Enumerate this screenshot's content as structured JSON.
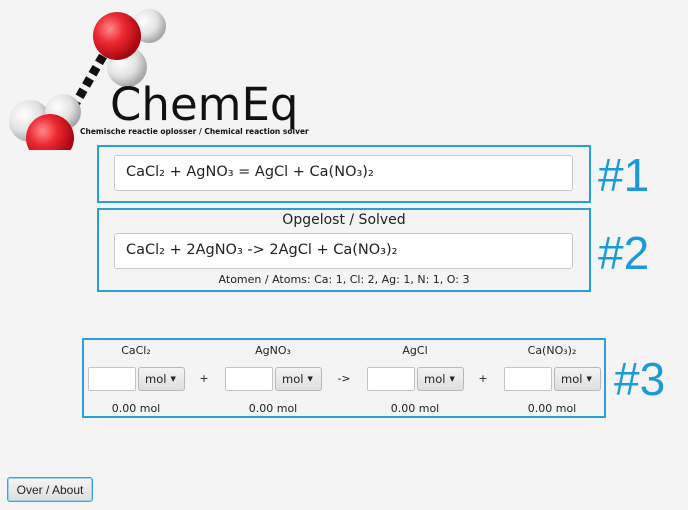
{
  "logo": {
    "title": "ChemEq",
    "subtitle": "Chemische reactie oplosser / Chemical reaction solver"
  },
  "input": {
    "equation": "CaCl₂ + AgNO₃ = AgCl + Ca(NO₃)₂"
  },
  "solved": {
    "heading": "Opgelost / Solved",
    "equation": "CaCl₂ + 2AgNO₃ -> 2AgCl + Ca(NO₃)₂",
    "atoms": "Atomen / Atoms: Ca: 1, Cl: 2, Ag: 1, N: 1, O: 3"
  },
  "annotations": {
    "one": "#1",
    "two": "#2",
    "three": "#3"
  },
  "calculator": {
    "plus1": "+",
    "arrow": "->",
    "plus2": "+",
    "compounds": [
      {
        "formula": "CaCl₂",
        "unit": "mol",
        "amount": "0.00 mol"
      },
      {
        "formula": "AgNO₃",
        "unit": "mol",
        "amount": "0.00 mol"
      },
      {
        "formula": "AgCl",
        "unit": "mol",
        "amount": "0.00 mol"
      },
      {
        "formula": "Ca(NO₃)₂",
        "unit": "mol",
        "amount": "0.00 mol"
      }
    ]
  },
  "about_button": "Over / About",
  "colors": {
    "accent": "#2aa1d6",
    "oxygen": "#e8202e",
    "hydrogen": "#e8e8e8"
  }
}
